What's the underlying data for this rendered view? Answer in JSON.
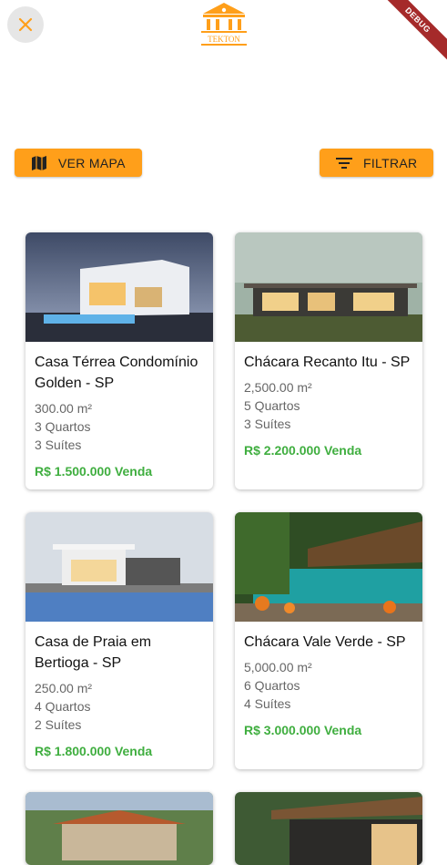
{
  "header": {
    "logo_text": "TEKTON",
    "debug_banner": "DEBUG"
  },
  "actions": {
    "map_label": "VER MAPA",
    "filter_label": "FILTRAR"
  },
  "colors": {
    "accent": "#ff9f1a",
    "price_green": "#3fae3f"
  },
  "listings": [
    {
      "title": "Casa Térrea Condomínio Golden - SP",
      "area": "300.00 m²",
      "rooms": "3 Quartos",
      "suites": "3 Suítes",
      "price": "R$ 1.500.000 Venda"
    },
    {
      "title": "Chácara Recanto Itu - SP",
      "area": "2,500.00 m²",
      "rooms": "5 Quartos",
      "suites": "3 Suítes",
      "price": "R$ 2.200.000 Venda"
    },
    {
      "title": "Casa de Praia em Bertioga - SP",
      "area": "250.00 m²",
      "rooms": "4 Quartos",
      "suites": "2 Suítes",
      "price": "R$ 1.800.000 Venda"
    },
    {
      "title": "Chácara Vale Verde - SP",
      "area": "5,000.00 m²",
      "rooms": "6 Quartos",
      "suites": "4 Suítes",
      "price": "R$ 3.000.000 Venda"
    }
  ]
}
